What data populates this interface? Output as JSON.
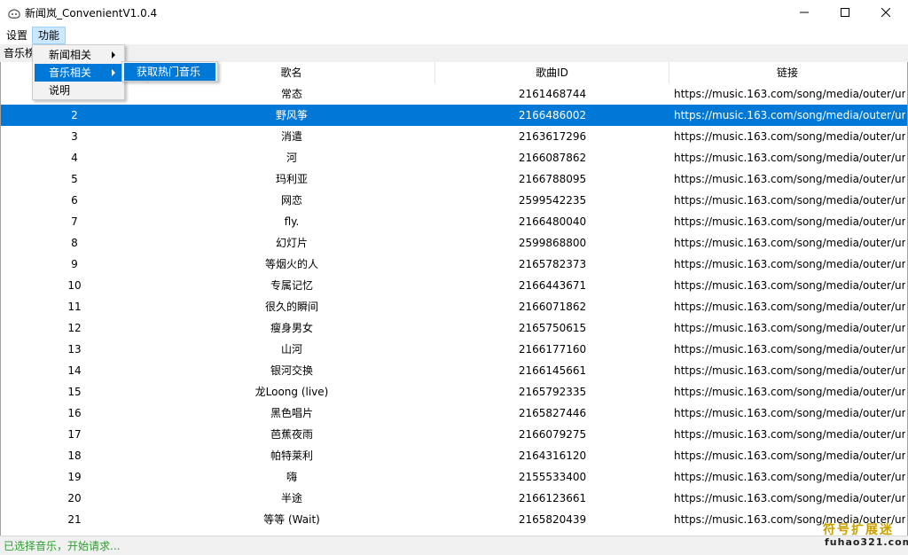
{
  "window": {
    "title": "新闻岚_ConvenientV1.0.4",
    "icon": "app-logo-icon",
    "controls": {
      "minimize": "minimize-icon",
      "maximize": "maximize-icon",
      "close": "close-icon"
    }
  },
  "menubar": {
    "items": [
      {
        "label": "设置"
      },
      {
        "label": "功能",
        "active": true
      }
    ]
  },
  "dropdown": {
    "items": [
      {
        "label": "新闻相关",
        "has_submenu": true
      },
      {
        "label": "音乐相关",
        "has_submenu": true,
        "highlighted": true
      },
      {
        "label": "说明",
        "has_submenu": false
      }
    ],
    "submenu": {
      "items": [
        {
          "label": "获取热门音乐"
        }
      ]
    }
  },
  "tab": {
    "label": "音乐榜"
  },
  "table": {
    "columns": [
      "",
      "歌名",
      "歌曲ID",
      "链接"
    ],
    "selected_index": 1,
    "rows": [
      {
        "idx": "",
        "name": "常态",
        "id": "2161468744",
        "link": "https://music.163.com/song/media/outer/ur"
      },
      {
        "idx": "2",
        "name": "野风筝",
        "id": "2166486002",
        "link": "https://music.163.com/song/media/outer/ur"
      },
      {
        "idx": "3",
        "name": "消遣",
        "id": "2163617296",
        "link": "https://music.163.com/song/media/outer/ur"
      },
      {
        "idx": "4",
        "name": "河",
        "id": "2166087862",
        "link": "https://music.163.com/song/media/outer/ur"
      },
      {
        "idx": "5",
        "name": "玛利亚",
        "id": "2166788095",
        "link": "https://music.163.com/song/media/outer/ur"
      },
      {
        "idx": "6",
        "name": "网恋",
        "id": "2599542235",
        "link": "https://music.163.com/song/media/outer/ur"
      },
      {
        "idx": "7",
        "name": "fly.",
        "id": "2166480040",
        "link": "https://music.163.com/song/media/outer/ur"
      },
      {
        "idx": "8",
        "name": "幻灯片",
        "id": "2599868800",
        "link": "https://music.163.com/song/media/outer/ur"
      },
      {
        "idx": "9",
        "name": "等烟火的人",
        "id": "2165782373",
        "link": "https://music.163.com/song/media/outer/ur"
      },
      {
        "idx": "10",
        "name": "专属记忆",
        "id": "2166443671",
        "link": "https://music.163.com/song/media/outer/ur"
      },
      {
        "idx": "11",
        "name": "很久的瞬间",
        "id": "2166071862",
        "link": "https://music.163.com/song/media/outer/ur"
      },
      {
        "idx": "12",
        "name": "瘦身男女",
        "id": "2165750615",
        "link": "https://music.163.com/song/media/outer/ur"
      },
      {
        "idx": "13",
        "name": "山河",
        "id": "2166177160",
        "link": "https://music.163.com/song/media/outer/ur"
      },
      {
        "idx": "14",
        "name": "银河交换",
        "id": "2166145661",
        "link": "https://music.163.com/song/media/outer/ur"
      },
      {
        "idx": "15",
        "name": "龙Loong (live)",
        "id": "2165792335",
        "link": "https://music.163.com/song/media/outer/ur"
      },
      {
        "idx": "16",
        "name": "黑色唱片",
        "id": "2165827446",
        "link": "https://music.163.com/song/media/outer/ur"
      },
      {
        "idx": "17",
        "name": "芭蕉夜雨",
        "id": "2166079275",
        "link": "https://music.163.com/song/media/outer/ur"
      },
      {
        "idx": "18",
        "name": "帕特莱利",
        "id": "2164316120",
        "link": "https://music.163.com/song/media/outer/ur"
      },
      {
        "idx": "19",
        "name": "嗨",
        "id": "2155533400",
        "link": "https://music.163.com/song/media/outer/ur"
      },
      {
        "idx": "20",
        "name": "半途",
        "id": "2166123661",
        "link": "https://music.163.com/song/media/outer/ur"
      },
      {
        "idx": "21",
        "name": "等等 (Wait)",
        "id": "2165820439",
        "link": "https://music.163.com/song/media/outer/ur"
      }
    ]
  },
  "status": {
    "text": "已选择音乐，开始请求..."
  },
  "watermark": {
    "cn": "符号扩展迷",
    "en": "fuhao321.com"
  },
  "colors": {
    "selection": "#0078d7",
    "menu_active": "#cce8ff",
    "status_text": "#2e9d2e",
    "watermark_gold": "#c9a000"
  }
}
